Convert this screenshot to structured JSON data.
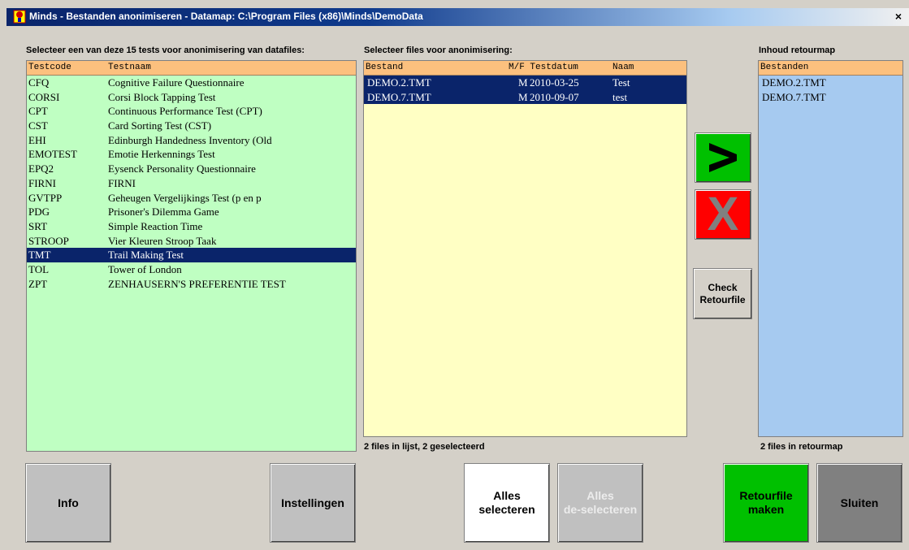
{
  "window": {
    "title": "Minds - Bestanden anonimiseren - Datamap: C:\\Program Files (x86)\\Minds\\DemoData",
    "close_glyph": "×"
  },
  "left": {
    "caption": "Selecteer een van deze 15 tests voor anonimisering van datafiles:",
    "columns": [
      "Testcode",
      "Testnaam"
    ],
    "rows": [
      {
        "code": "CFQ",
        "name": "Cognitive Failure Questionnaire"
      },
      {
        "code": "CORSI",
        "name": "Corsi Block Tapping Test"
      },
      {
        "code": "CPT",
        "name": "Continuous Performance Test (CPT)"
      },
      {
        "code": "CST",
        "name": "Card Sorting Test (CST)"
      },
      {
        "code": "EHI",
        "name": "Edinburgh Handedness Inventory (Old"
      },
      {
        "code": "EMOTEST",
        "name": "Emotie Herkennings Test"
      },
      {
        "code": "EPQ2",
        "name": "Eysenck Personality Questionnaire"
      },
      {
        "code": "FIRNI",
        "name": "FIRNI"
      },
      {
        "code": "GVTPP",
        "name": "Geheugen Vergelijkings Test (p en p"
      },
      {
        "code": "PDG",
        "name": "Prisoner's Dilemma Game"
      },
      {
        "code": "SRT",
        "name": "Simple Reaction Time"
      },
      {
        "code": "STROOP",
        "name": "Vier Kleuren Stroop Taak"
      },
      {
        "code": "TMT",
        "name": "Trail Making Test"
      },
      {
        "code": "TOL",
        "name": "Tower of London"
      },
      {
        "code": "ZPT",
        "name": "ZENHAUSERN'S PREFERENTIE TEST"
      }
    ],
    "selected_code": "TMT"
  },
  "middle": {
    "caption": "Selecteer files voor anonimisering:",
    "columns": [
      "Bestand",
      "M/F Testdatum",
      "Naam"
    ],
    "rows": [
      {
        "file": "DEMO.2.TMT",
        "sex": "M",
        "date": "2010-03-25",
        "name": "Test"
      },
      {
        "file": "DEMO.7.TMT",
        "sex": "M",
        "date": "2010-09-07",
        "name": "test"
      }
    ],
    "status": "2 files in lijst, 2 geselecteerd"
  },
  "right": {
    "caption": "Inhoud retourmap",
    "column": "Bestanden",
    "rows": [
      "DEMO.2.TMT",
      "DEMO.7.TMT"
    ],
    "status": "2 files in retourmap"
  },
  "actions": {
    "add_glyph": ">",
    "remove_glyph": "X",
    "check_label": "Check\nRetourfile"
  },
  "buttons": {
    "info": "Info",
    "settings": "Instellingen",
    "select_all": "Alles\nselecteren",
    "deselect_all": "Alles\nde-selecteren",
    "make_return": "Retourfile\nmaken",
    "close": "Sluiten"
  },
  "colors": {
    "left_list_bg": "#bfffc2",
    "middle_list_bg": "#ffffc4",
    "right_list_bg": "#a6caf0",
    "header_bg": "#fcc07e",
    "selection_bg": "#0a246a",
    "green_button": "#00c000",
    "red_button": "#ff0000",
    "gray_button": "#c0c0c0",
    "dark_gray_button": "#808080"
  }
}
